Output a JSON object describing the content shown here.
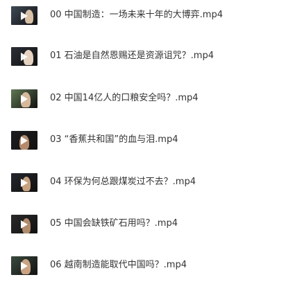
{
  "files": [
    {
      "name": "00 中国制造：一场未来十年的大博弈.mp4",
      "thumb_icon": "video-thumbnail-icon",
      "bg": "#3f4a56",
      "fig": "#d9c1a5"
    },
    {
      "name": "01 石油是自然恩赐还是资源诅咒？.mp4",
      "thumb_icon": "video-thumbnail-icon",
      "bg": "#2b2f36",
      "fig": "#e6d3bf"
    },
    {
      "name": "02 中国14亿人的口粮安全吗？.mp4",
      "thumb_icon": "video-thumbnail-icon",
      "bg": "#5f7a52",
      "fig": "#d8b89a"
    },
    {
      "name": "03 “香蕉共和国”的血与泪.mp4",
      "thumb_icon": "video-thumbnail-icon",
      "bg": "#1e1e22",
      "fig": "#b58a6a"
    },
    {
      "name": "04 环保为何总跟煤炭过不去？.mp4",
      "thumb_icon": "video-thumbnail-icon",
      "bg": "#24262c",
      "fig": "#c7a27c"
    },
    {
      "name": "05 中国会缺铁矿石用吗？.mp4",
      "thumb_icon": "video-thumbnail-icon",
      "bg": "#2a2a2a",
      "fig": "#b28b6a"
    },
    {
      "name": "06 越南制造能取代中国吗？.mp4",
      "thumb_icon": "video-thumbnail-icon",
      "bg": "#3a4b3f",
      "fig": "#caa383"
    }
  ]
}
